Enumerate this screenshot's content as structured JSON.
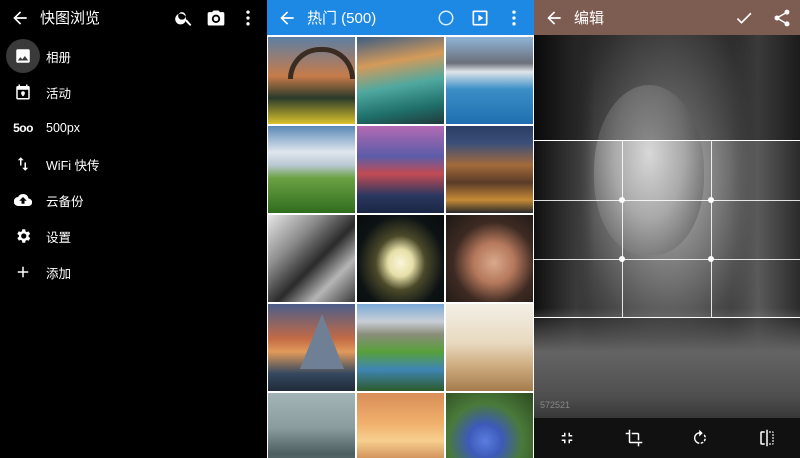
{
  "drawer": {
    "title": "快图浏览",
    "items": [
      {
        "label": "相册",
        "icon": "photo-album-icon"
      },
      {
        "label": "活动",
        "icon": "calendar-event-icon"
      },
      {
        "label": "500px",
        "icon": "500px-logo-icon"
      },
      {
        "label": "WiFi 快传",
        "icon": "transfer-arrows-icon"
      },
      {
        "label": "云备份",
        "icon": "cloud-upload-icon"
      },
      {
        "label": "设置",
        "icon": "gear-icon"
      },
      {
        "label": "添加",
        "icon": "plus-icon"
      }
    ],
    "logo_500": "5oo"
  },
  "gallery": {
    "title": "热门 (500)",
    "accent": "#1e88e5",
    "tiles": [
      "bridge-sunset",
      "coastal-rocks",
      "mountain-lake",
      "green-field",
      "cliff-village",
      "canal-houses",
      "architecture-bw",
      "water-lily",
      "portrait-woman",
      "pyramid-sunset",
      "alpine-meadow",
      "open-book",
      "misty-forest",
      "golden-lake",
      "blue-flower"
    ]
  },
  "editor": {
    "title": "编辑",
    "accent": "#7d5c52",
    "watermark": "572521",
    "tools": [
      "collapse-icon",
      "crop-icon",
      "rotate-icon",
      "flip-icon"
    ]
  }
}
